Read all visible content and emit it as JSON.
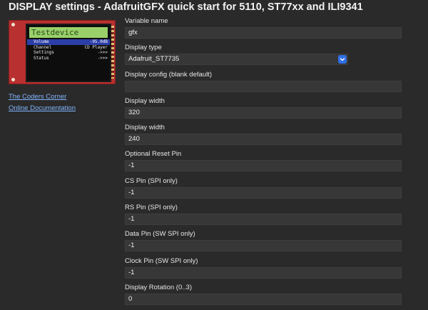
{
  "page": {
    "title": "DISPLAY settings - AdafruitGFX quick start for 5110, ST77xx and ILI9341"
  },
  "device_image": {
    "header": "Testdevice",
    "rows": [
      {
        "label": "Volume",
        "value": "-95.0dB",
        "selected": true
      },
      {
        "label": "Channel",
        "value": "CD Player",
        "selected": false
      },
      {
        "label": "Settings",
        "value": "->>>",
        "selected": false
      },
      {
        "label": "Status",
        "value": "->>>",
        "selected": false
      }
    ]
  },
  "links": {
    "coders_corner": "The Coders Corner",
    "online_docs": "Online Documentation"
  },
  "form": {
    "variable_name": {
      "label": "Variable name",
      "value": "gfx"
    },
    "display_type": {
      "label": "Display type",
      "value": "Adafruit_ST7735"
    },
    "display_config": {
      "label": "Display config (blank default)",
      "value": ""
    },
    "display_width": {
      "label": "Display width",
      "value": "320"
    },
    "display_height": {
      "label": "Display width",
      "value": "240"
    },
    "reset_pin": {
      "label": "Optional Reset Pin",
      "value": "-1"
    },
    "cs_pin": {
      "label": "CS Pin (SPI only)",
      "value": "-1"
    },
    "rs_pin": {
      "label": "RS Pin (SPI only)",
      "value": "-1"
    },
    "data_pin": {
      "label": "Data Pin (SW SPI only)",
      "value": "-1"
    },
    "clock_pin": {
      "label": "Clock Pin (SW SPI only)",
      "value": "-1"
    },
    "rotation": {
      "label": "Display Rotation (0..3)",
      "value": "0"
    }
  }
}
